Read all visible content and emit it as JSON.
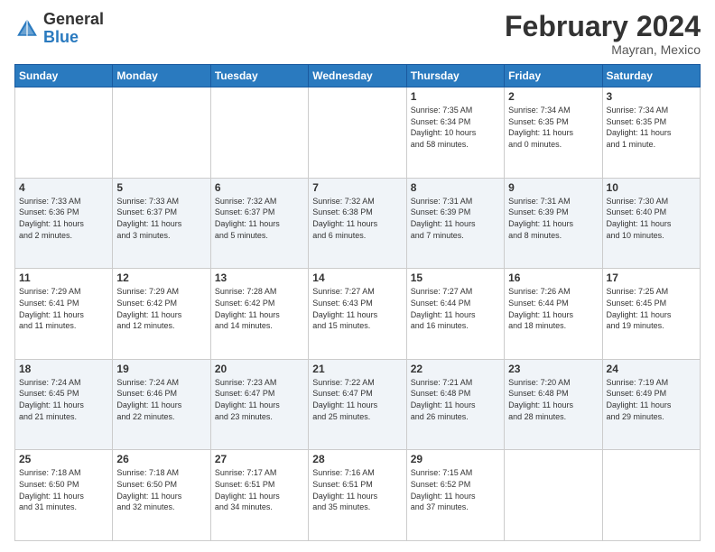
{
  "header": {
    "logo": {
      "general": "General",
      "blue": "Blue"
    },
    "title": "February 2024",
    "location": "Mayran, Mexico"
  },
  "weekdays": [
    "Sunday",
    "Monday",
    "Tuesday",
    "Wednesday",
    "Thursday",
    "Friday",
    "Saturday"
  ],
  "weeks": [
    [
      {
        "day": "",
        "info": ""
      },
      {
        "day": "",
        "info": ""
      },
      {
        "day": "",
        "info": ""
      },
      {
        "day": "",
        "info": ""
      },
      {
        "day": "1",
        "info": "Sunrise: 7:35 AM\nSunset: 6:34 PM\nDaylight: 10 hours\nand 58 minutes."
      },
      {
        "day": "2",
        "info": "Sunrise: 7:34 AM\nSunset: 6:35 PM\nDaylight: 11 hours\nand 0 minutes."
      },
      {
        "day": "3",
        "info": "Sunrise: 7:34 AM\nSunset: 6:35 PM\nDaylight: 11 hours\nand 1 minute."
      }
    ],
    [
      {
        "day": "4",
        "info": "Sunrise: 7:33 AM\nSunset: 6:36 PM\nDaylight: 11 hours\nand 2 minutes."
      },
      {
        "day": "5",
        "info": "Sunrise: 7:33 AM\nSunset: 6:37 PM\nDaylight: 11 hours\nand 3 minutes."
      },
      {
        "day": "6",
        "info": "Sunrise: 7:32 AM\nSunset: 6:37 PM\nDaylight: 11 hours\nand 5 minutes."
      },
      {
        "day": "7",
        "info": "Sunrise: 7:32 AM\nSunset: 6:38 PM\nDaylight: 11 hours\nand 6 minutes."
      },
      {
        "day": "8",
        "info": "Sunrise: 7:31 AM\nSunset: 6:39 PM\nDaylight: 11 hours\nand 7 minutes."
      },
      {
        "day": "9",
        "info": "Sunrise: 7:31 AM\nSunset: 6:39 PM\nDaylight: 11 hours\nand 8 minutes."
      },
      {
        "day": "10",
        "info": "Sunrise: 7:30 AM\nSunset: 6:40 PM\nDaylight: 11 hours\nand 10 minutes."
      }
    ],
    [
      {
        "day": "11",
        "info": "Sunrise: 7:29 AM\nSunset: 6:41 PM\nDaylight: 11 hours\nand 11 minutes."
      },
      {
        "day": "12",
        "info": "Sunrise: 7:29 AM\nSunset: 6:42 PM\nDaylight: 11 hours\nand 12 minutes."
      },
      {
        "day": "13",
        "info": "Sunrise: 7:28 AM\nSunset: 6:42 PM\nDaylight: 11 hours\nand 14 minutes."
      },
      {
        "day": "14",
        "info": "Sunrise: 7:27 AM\nSunset: 6:43 PM\nDaylight: 11 hours\nand 15 minutes."
      },
      {
        "day": "15",
        "info": "Sunrise: 7:27 AM\nSunset: 6:44 PM\nDaylight: 11 hours\nand 16 minutes."
      },
      {
        "day": "16",
        "info": "Sunrise: 7:26 AM\nSunset: 6:44 PM\nDaylight: 11 hours\nand 18 minutes."
      },
      {
        "day": "17",
        "info": "Sunrise: 7:25 AM\nSunset: 6:45 PM\nDaylight: 11 hours\nand 19 minutes."
      }
    ],
    [
      {
        "day": "18",
        "info": "Sunrise: 7:24 AM\nSunset: 6:45 PM\nDaylight: 11 hours\nand 21 minutes."
      },
      {
        "day": "19",
        "info": "Sunrise: 7:24 AM\nSunset: 6:46 PM\nDaylight: 11 hours\nand 22 minutes."
      },
      {
        "day": "20",
        "info": "Sunrise: 7:23 AM\nSunset: 6:47 PM\nDaylight: 11 hours\nand 23 minutes."
      },
      {
        "day": "21",
        "info": "Sunrise: 7:22 AM\nSunset: 6:47 PM\nDaylight: 11 hours\nand 25 minutes."
      },
      {
        "day": "22",
        "info": "Sunrise: 7:21 AM\nSunset: 6:48 PM\nDaylight: 11 hours\nand 26 minutes."
      },
      {
        "day": "23",
        "info": "Sunrise: 7:20 AM\nSunset: 6:48 PM\nDaylight: 11 hours\nand 28 minutes."
      },
      {
        "day": "24",
        "info": "Sunrise: 7:19 AM\nSunset: 6:49 PM\nDaylight: 11 hours\nand 29 minutes."
      }
    ],
    [
      {
        "day": "25",
        "info": "Sunrise: 7:18 AM\nSunset: 6:50 PM\nDaylight: 11 hours\nand 31 minutes."
      },
      {
        "day": "26",
        "info": "Sunrise: 7:18 AM\nSunset: 6:50 PM\nDaylight: 11 hours\nand 32 minutes."
      },
      {
        "day": "27",
        "info": "Sunrise: 7:17 AM\nSunset: 6:51 PM\nDaylight: 11 hours\nand 34 minutes."
      },
      {
        "day": "28",
        "info": "Sunrise: 7:16 AM\nSunset: 6:51 PM\nDaylight: 11 hours\nand 35 minutes."
      },
      {
        "day": "29",
        "info": "Sunrise: 7:15 AM\nSunset: 6:52 PM\nDaylight: 11 hours\nand 37 minutes."
      },
      {
        "day": "",
        "info": ""
      },
      {
        "day": "",
        "info": ""
      }
    ]
  ]
}
